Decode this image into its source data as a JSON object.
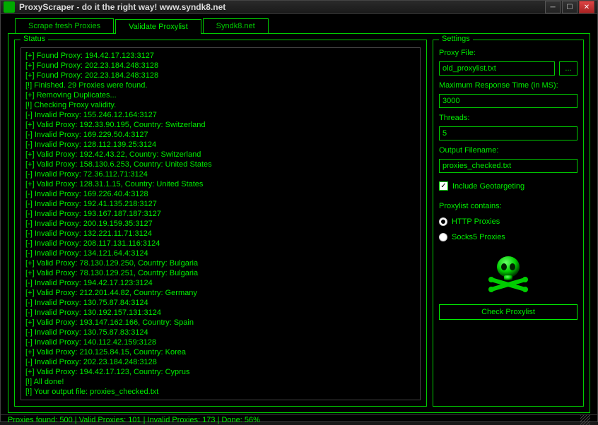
{
  "window": {
    "title": "ProxyScraper - do it the right way! www.syndk8.net"
  },
  "tabs": [
    {
      "label": "Scrape fresh Proxies"
    },
    {
      "label": "Validate Proxylist"
    },
    {
      "label": "Syndk8.net"
    }
  ],
  "active_tab": 1,
  "status": {
    "title": "Status",
    "lines": [
      "[+] Found Proxy: 194.42.17.123:3127",
      "[+] Found Proxy: 202.23.184.248:3128",
      "[+] Found Proxy: 202.23.184.248:3128",
      "[!] Finished. 29 Proxies were found.",
      "[+] Removing Duplicates...",
      "[!] Checking Proxy validity.",
      "[-] Invalid Proxy: 155.246.12.164:3127",
      "[+] Valid Proxy: 192.33.90.195, Country: Switzerland",
      "[-] Invalid Proxy: 169.229.50.4:3127",
      "[-] Invalid Proxy: 128.112.139.25:3124",
      "[+] Valid Proxy: 192.42.43.22, Country: Switzerland",
      "[+] Valid Proxy: 158.130.6.253, Country: United States",
      "[-] Invalid Proxy: 72.36.112.71:3124",
      "[+] Valid Proxy: 128.31.1.15, Country: United States",
      "[-] Invalid Proxy: 169.226.40.4:3128",
      "[-] Invalid Proxy: 192.41.135.218:3127",
      "[-] Invalid Proxy: 193.167.187.187:3127",
      "[-] Invalid Proxy: 200.19.159.35:3127",
      "[-] Invalid Proxy: 132.221.11.71:3124",
      "[-] Invalid Proxy: 208.117.131.116:3124",
      "[-] Invalid Proxy: 134.121.64.4:3124",
      "[+] Valid Proxy: 78.130.129.250, Country: Bulgaria",
      "[+] Valid Proxy: 78.130.129.251, Country: Bulgaria",
      "[-] Invalid Proxy: 194.42.17.123:3124",
      "[+] Valid Proxy: 212.201.44.82, Country: Germany",
      "[-] Invalid Proxy: 130.75.87.84:3124",
      "[-] Invalid Proxy: 130.192.157.131:3124",
      "[+] Valid Proxy: 193.147.162.166, Country: Spain",
      "[-] Invalid Proxy: 130.75.87.83:3124",
      "[-] Invalid Proxy: 140.112.42.159:3128",
      "[+] Valid Proxy: 210.125.84.15, Country: Korea",
      "[-] Invalid Proxy: 202.23.184.248:3128",
      "[+] Valid Proxy: 194.42.17.123, Country: Cyprus",
      "[!] All done!",
      "[!] Your output file: proxies_checked.txt"
    ]
  },
  "settings": {
    "title": "Settings",
    "proxy_file_label": "Proxy File:",
    "proxy_file_value": "old_proxylist.txt",
    "browse_label": "...",
    "max_response_label": "Maximum Response Time (in MS):",
    "max_response_value": "3000",
    "threads_label": "Threads:",
    "threads_value": "5",
    "output_label": "Output Filename:",
    "output_value": "proxies_checked.txt",
    "geo_label": "Include Geotargeting",
    "geo_checked": true,
    "contains_label": "Proxylist contains:",
    "radio_http": "HTTP Proxies",
    "radio_socks": "Socks5 Proxies",
    "radio_selected": "http",
    "check_button": "Check Proxylist"
  },
  "statusbar": "Proxies found: 500 | Valid Proxies: 101 | Invalid Proxies: 173 | Done: 56%"
}
